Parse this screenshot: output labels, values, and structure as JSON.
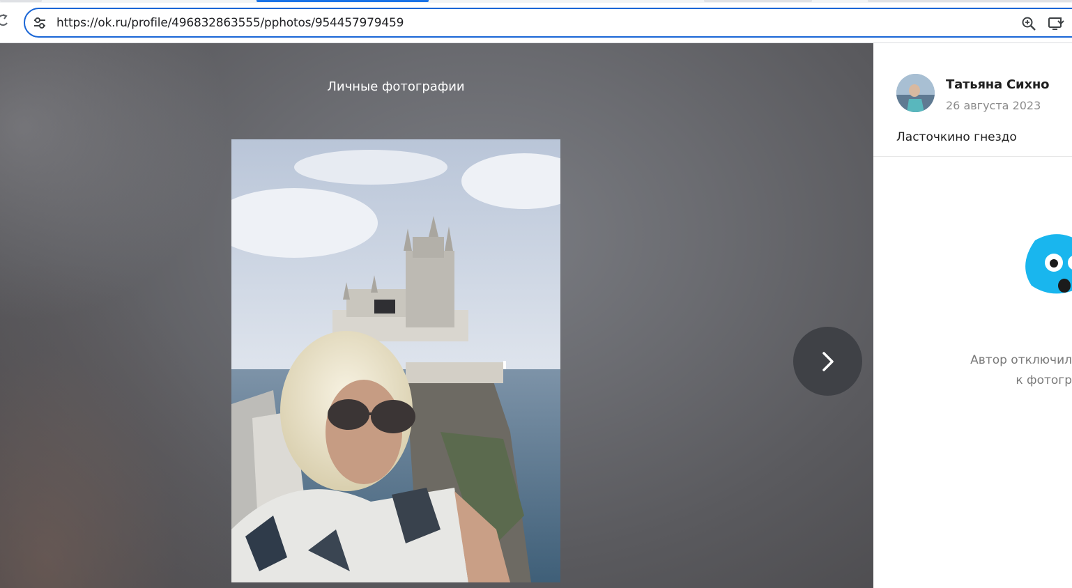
{
  "browser": {
    "url": "https://ok.ru/profile/496832863555/pphotos/954457979459",
    "icons": {
      "reload": "reload-icon",
      "site_info": "tune-icon",
      "zoom": "zoom-icon",
      "install": "install-app-icon"
    }
  },
  "viewer": {
    "album_title": "Личные фотографии",
    "next_icon": "chevron-right-icon"
  },
  "panel": {
    "author_name": "Татьяна Сихно",
    "post_date": "26 августа 2023",
    "caption": "Ласточкино гнездо",
    "comments_disabled_line1": "Автор отключил",
    "comments_disabled_line2": "к фотогр"
  },
  "colors": {
    "omnibox_border": "#1a66d6",
    "viewer_bg": "#65666b",
    "next_button": "#3f4146",
    "mascot": "#19b6ee"
  }
}
